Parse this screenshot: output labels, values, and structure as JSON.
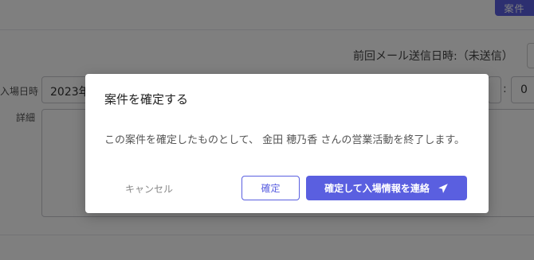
{
  "header": {
    "top_button_label": "案件"
  },
  "form": {
    "last_sent_label": "前回メール送信日時:（未送信）",
    "entry_date_label": "入場日時",
    "entry_date_value": "2023年",
    "time_minute_value": "0",
    "time_separator": ":",
    "detail_label": "詳細"
  },
  "modal": {
    "title": "案件を確定する",
    "message": "この案件を確定したものとして、 金田 穂乃香 さんの営業活動を終了します。",
    "cancel_label": "キャンセル",
    "confirm_label": "確定",
    "confirm_notify_label": "確定して入場情報を連絡",
    "confirm_notify_icon": "send-icon"
  },
  "colors": {
    "accent": "#5a5fe0",
    "overlay": "rgba(0,0,0,0.5)"
  }
}
